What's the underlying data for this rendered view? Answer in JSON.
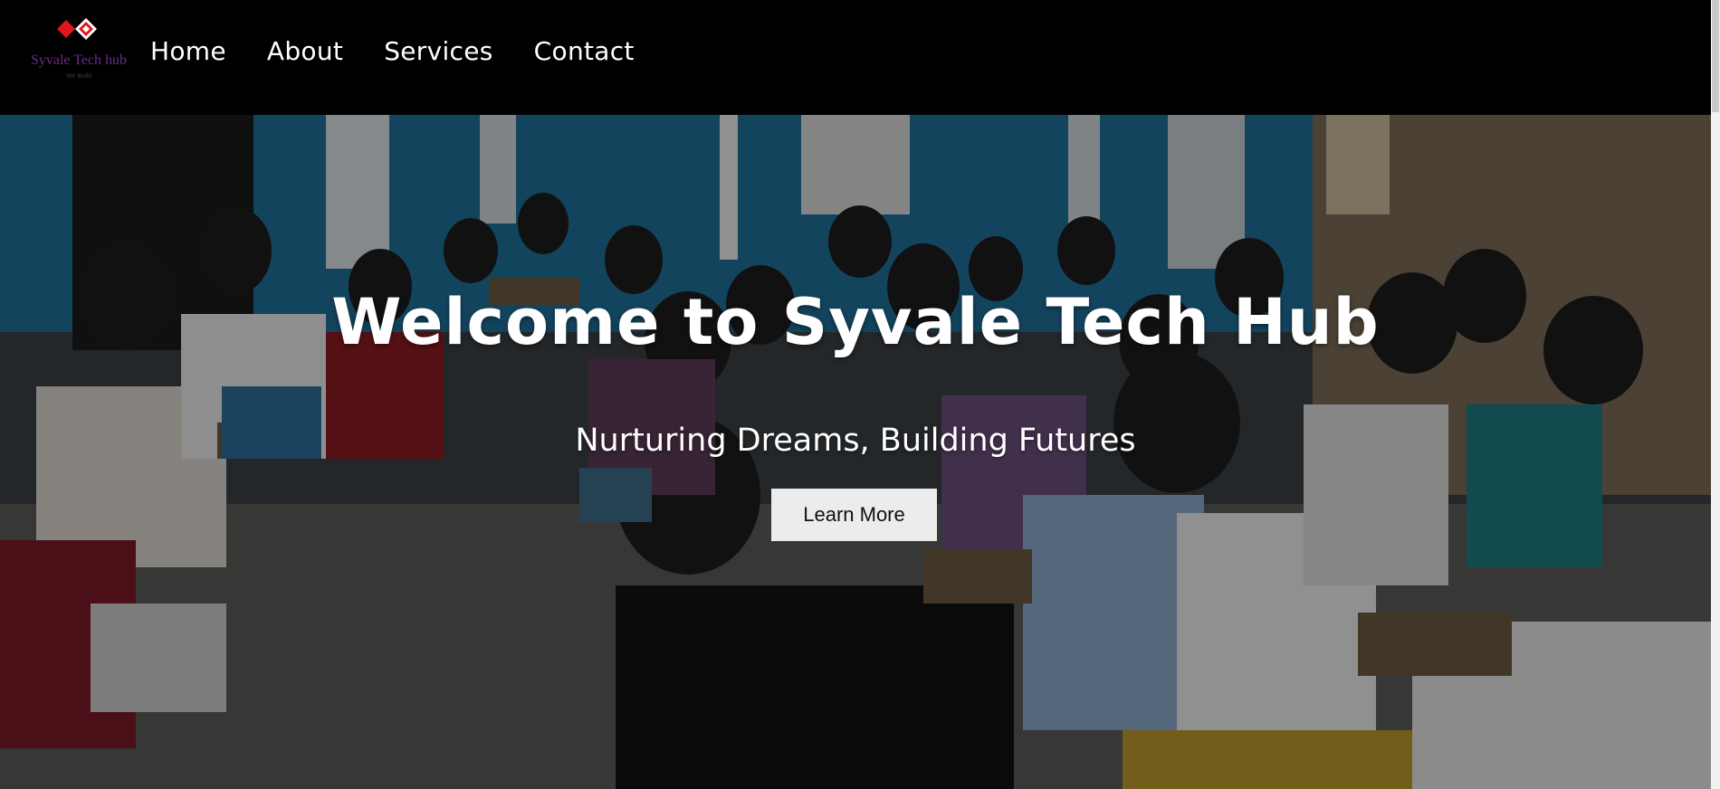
{
  "brand": {
    "name": "Syvale Tech hub",
    "tagline": "We Build",
    "colors": {
      "mark": "#e0161c",
      "name": "#6a2b8a"
    }
  },
  "nav": {
    "items": [
      {
        "label": "Home"
      },
      {
        "label": "About"
      },
      {
        "label": "Services"
      },
      {
        "label": "Contact"
      }
    ]
  },
  "hero": {
    "title": "Welcome to Syvale Tech Hub",
    "subtitle": "Nurturing Dreams, Building Futures",
    "cta_label": "Learn More",
    "background": "photo-classroom-audience"
  }
}
